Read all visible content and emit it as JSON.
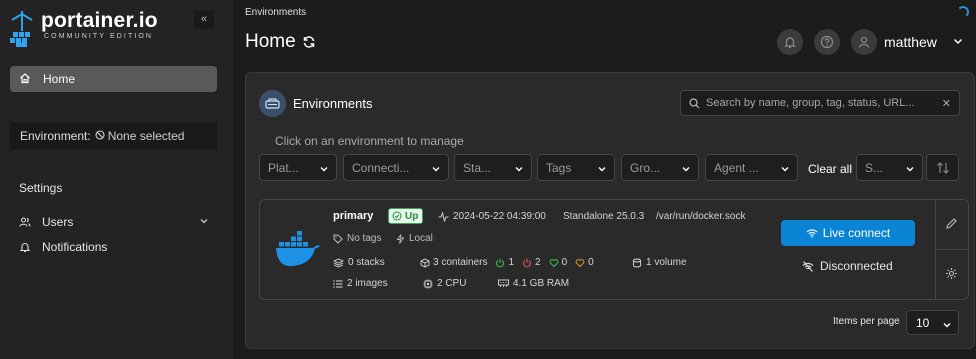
{
  "sidebar": {
    "logo_name": "portainer.io",
    "logo_subtitle": "COMMUNITY EDITION",
    "collapse_label": "«",
    "home_label": "Home",
    "environment_label": "Environment:",
    "environment_value": "None selected",
    "settings_label": "Settings",
    "users_label": "Users",
    "notifications_label": "Notifications"
  },
  "header": {
    "breadcrumb": "Environments",
    "title": "Home",
    "user_name": "matthew"
  },
  "card": {
    "title": "Environments",
    "search_placeholder": "Search by name, group, tag, status, URL...",
    "hint": "Click on an environment to manage",
    "filters": [
      "Plat...",
      "Connecti...",
      "Sta...",
      "Tags",
      "Gro...",
      "Agent ..."
    ],
    "clear_all": "Clear all",
    "sort_select": "S...",
    "items_per_page_label": "Items per page",
    "items_per_page_value": "10"
  },
  "environment": {
    "name": "primary",
    "status": "Up",
    "timestamp": "2024-05-22 04:39:00",
    "type": "Standalone 25.0.3",
    "url": "/var/run/docker.sock",
    "tags": "No tags",
    "group": "Local",
    "stacks": "0 stacks",
    "containers": "3 containers",
    "running": "1",
    "stopped": "2",
    "healthy": "0",
    "unhealthy": "0",
    "volumes": "1 volume",
    "images": "2 images",
    "cpu": "2 CPU",
    "ram": "4.1 GB RAM",
    "live_connect": "Live connect",
    "disconnected": "Disconnected"
  },
  "colors": {
    "accent": "#0b84d6",
    "status_up": "#2a8a3e",
    "running": "#3fb950",
    "stopped": "#e5534b",
    "healthy": "#3fb950",
    "unhealthy": "#d29922"
  },
  "icons": [
    "home-icon",
    "ban-icon",
    "users-icon",
    "bell-icon",
    "help-icon",
    "user-icon",
    "refresh-icon",
    "environments-icon",
    "search-icon",
    "docker-icon",
    "tag-icon",
    "plug-icon",
    "wifi-icon",
    "wifi-off-icon",
    "edit-icon",
    "gear-icon"
  ]
}
